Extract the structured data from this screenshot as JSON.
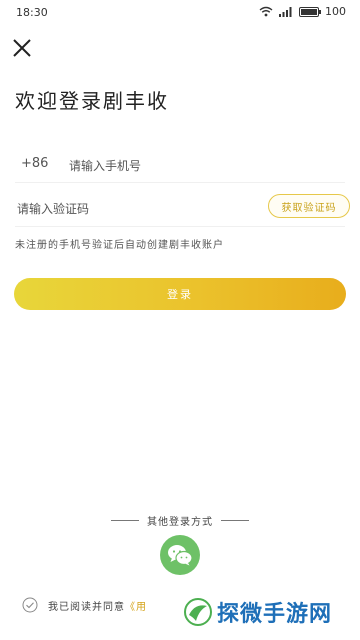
{
  "status_bar": {
    "time": "18:30",
    "battery": "100",
    "battery_level_percent": 100,
    "icons": [
      "wifi-icon",
      "signal-icon",
      "battery-icon"
    ]
  },
  "header": {
    "close_icon": "close-icon",
    "title": "欢迎登录剧丰收"
  },
  "phone": {
    "country_code": "+86",
    "placeholder": "请输入手机号"
  },
  "code": {
    "placeholder": "请输入验证码",
    "get_code_label": "获取验证码"
  },
  "hint": "未注册的手机号验证后自动创建剧丰收账户",
  "login_button": "登录",
  "other_login": {
    "label": "其他登录方式",
    "wechat_icon": "wechat-icon"
  },
  "agreement": {
    "text": "我已阅读并同意",
    "link": "《用"
  },
  "watermark": {
    "text": "探微手游网"
  },
  "colors": {
    "accent": "#e8c22c",
    "accent_text": "#c9a21a",
    "wechat": "#6ec167",
    "watermark": "#1e6fb8"
  }
}
